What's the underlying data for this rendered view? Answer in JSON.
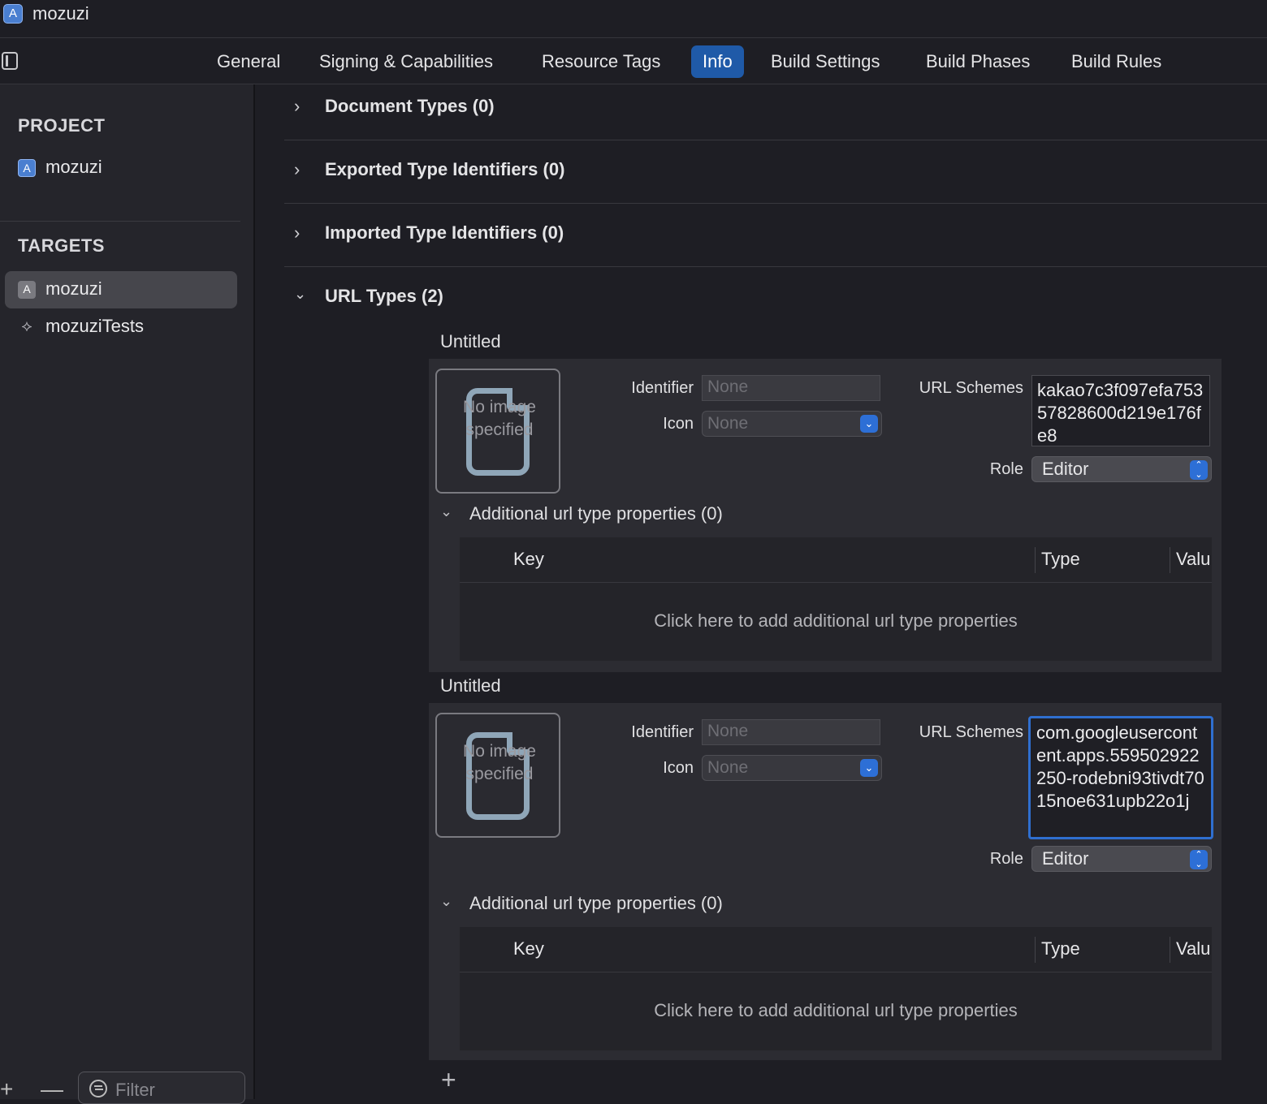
{
  "window": {
    "title": "mozuzi"
  },
  "tabs": [
    "General",
    "Signing & Capabilities",
    "Resource Tags",
    "Info",
    "Build Settings",
    "Build Phases",
    "Build Rules"
  ],
  "active_tab": "Info",
  "sidebar": {
    "project_header": "PROJECT",
    "project_items": [
      {
        "label": "mozuzi",
        "icon": "app-icon"
      }
    ],
    "targets_header": "TARGETS",
    "target_items": [
      {
        "label": "mozuzi",
        "icon": "app-icon",
        "selected": true
      },
      {
        "label": "mozuziTests",
        "icon": "test-bundle-icon",
        "selected": false
      }
    ],
    "filter_placeholder": "Filter",
    "add_label": "+",
    "remove_label": "—"
  },
  "sections": [
    {
      "title": "Document Types (0)",
      "expanded": false
    },
    {
      "title": "Exported Type Identifiers (0)",
      "expanded": false
    },
    {
      "title": "Imported Type Identifiers (0)",
      "expanded": false
    },
    {
      "title": "URL Types (2)",
      "expanded": true
    }
  ],
  "url_types": [
    {
      "name": "Untitled",
      "image_placeholder": "No image specified",
      "identifier_label": "Identifier",
      "identifier_placeholder": "None",
      "icon_label": "Icon",
      "icon_value": "None",
      "schemes_label": "URL Schemes",
      "schemes_value": "kakao7c3f097efa75357828600d219e176fe8",
      "role_label": "Role",
      "role_value": "Editor",
      "additional_title": "Additional url type properties (0)",
      "table_columns": [
        "Key",
        "Type",
        "Valu"
      ],
      "table_empty_text": "Click here to add additional url type properties"
    },
    {
      "name": "Untitled",
      "image_placeholder": "No image specified",
      "identifier_label": "Identifier",
      "identifier_placeholder": "None",
      "icon_label": "Icon",
      "icon_value": "None",
      "schemes_label": "URL Schemes",
      "schemes_value": "com.googleusercontent.apps.559502922250-rodebni93tivdt7015noe631upb22o1j",
      "role_label": "Role",
      "role_value": "Editor",
      "additional_title": "Additional url type properties (0)",
      "table_columns": [
        "Key",
        "Type",
        "Valu"
      ],
      "table_empty_text": "Click here to add additional url type properties"
    }
  ],
  "add_url_type_label": "+",
  "colors": {
    "accent": "#1f5aa8",
    "background": "#1e1e24",
    "sidebar": "#25252b",
    "card": "#2c2c32"
  }
}
